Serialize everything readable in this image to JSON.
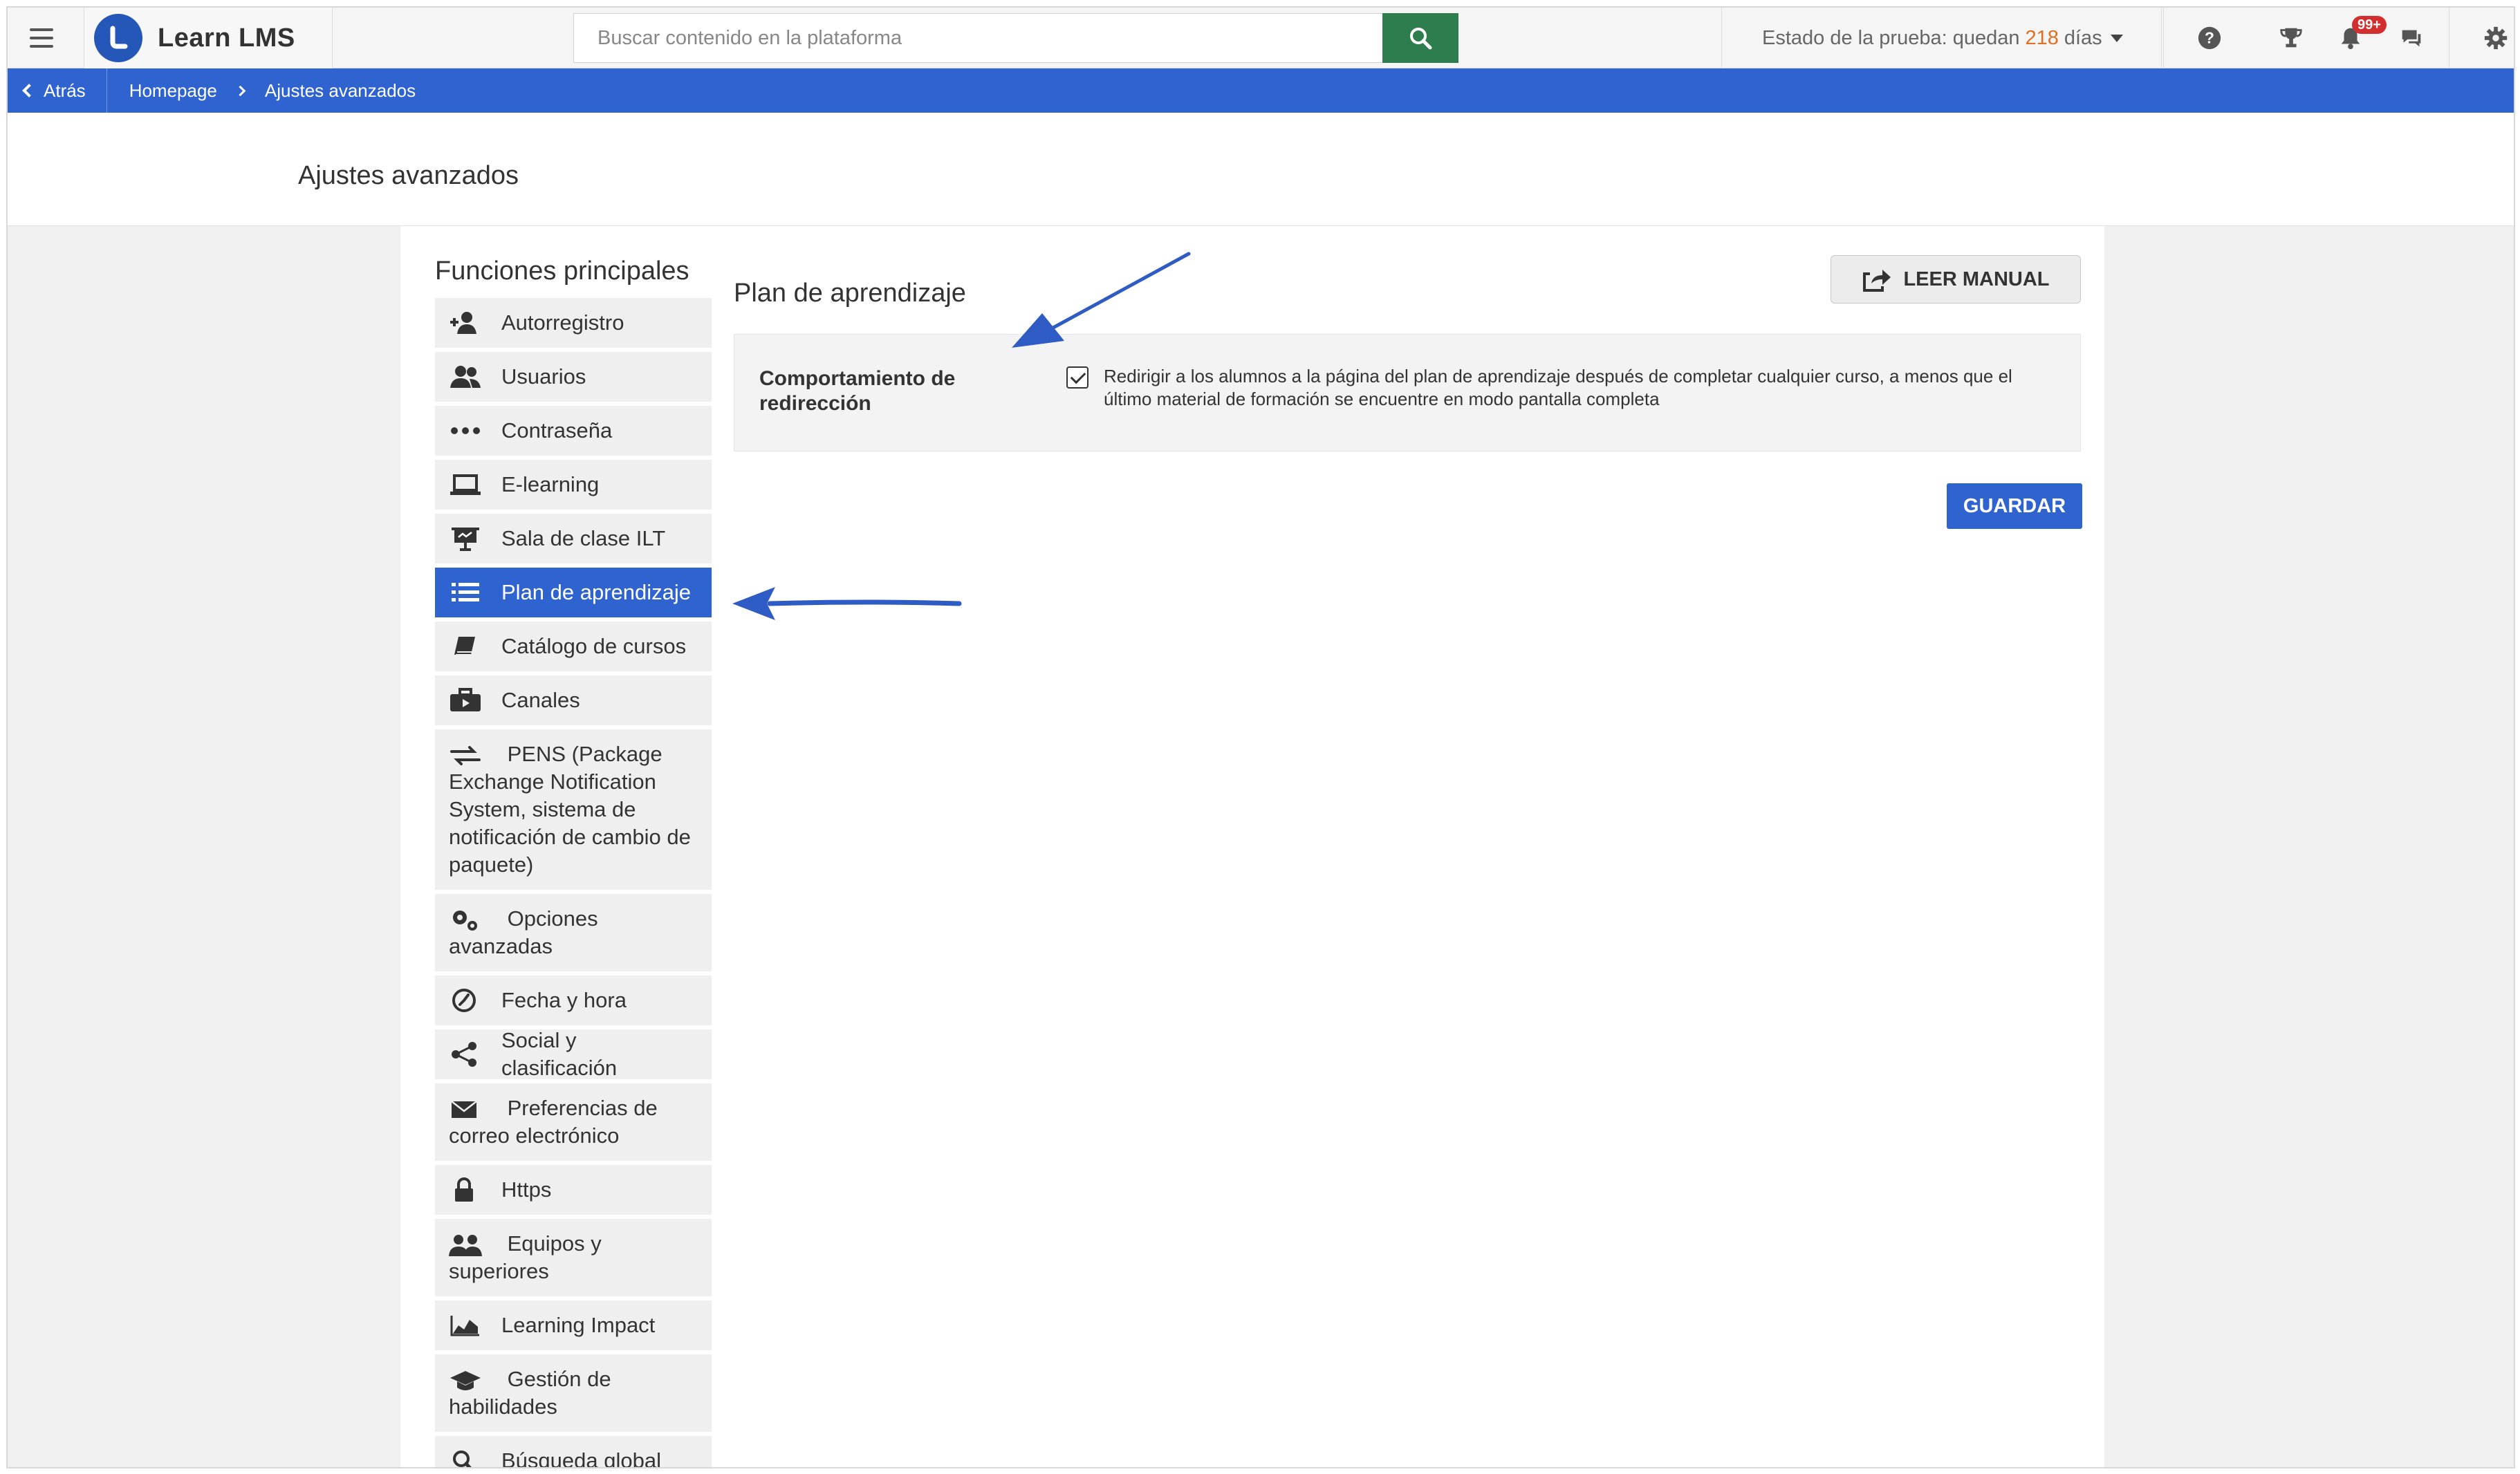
{
  "app": {
    "name": "Learn LMS"
  },
  "search": {
    "placeholder": "Buscar contenido en la plataforma"
  },
  "trial": {
    "prefix": "Estado de la prueba: quedan",
    "days": "218",
    "suffix": "días"
  },
  "notifications": {
    "badge": "99+"
  },
  "breadcrumb": {
    "back": "Atrás",
    "home": "Homepage",
    "current": "Ajustes avanzados"
  },
  "page": {
    "title": "Ajustes avanzados"
  },
  "sidebar": {
    "title": "Funciones principales",
    "items": [
      {
        "label": "Autorregistro",
        "icon": "user-add-icon"
      },
      {
        "label": "Usuarios",
        "icon": "users-icon"
      },
      {
        "label": "Contraseña",
        "icon": "password-dots-icon"
      },
      {
        "label": "E-learning",
        "icon": "laptop-icon"
      },
      {
        "label": "Sala de clase ILT",
        "icon": "presentation-icon"
      },
      {
        "label": "Plan de aprendizaje",
        "icon": "list-icon",
        "active": true
      },
      {
        "label": "Catálogo de cursos",
        "icon": "book-icon"
      },
      {
        "label": "Canales",
        "icon": "briefcase-icon"
      },
      {
        "label": "PENS (Package Exchange Notification System, sistema de notificación de cambio de paquete)",
        "icon": "exchange-icon"
      },
      {
        "label": "Opciones avanzadas",
        "icon": "gears-icon"
      },
      {
        "label": "Fecha y hora",
        "icon": "clock-icon"
      },
      {
        "label": "Social y clasificación",
        "icon": "share-icon"
      },
      {
        "label": "Preferencias de correo electrónico",
        "icon": "envelope-icon"
      },
      {
        "label": "Https",
        "icon": "lock-icon"
      },
      {
        "label": "Equipos y superiores",
        "icon": "team-icon"
      },
      {
        "label": "Learning Impact",
        "icon": "area-chart-icon"
      },
      {
        "label": "Gestión de habilidades",
        "icon": "graduation-cap-icon"
      },
      {
        "label": "Búsqueda global",
        "icon": "search-icon"
      }
    ]
  },
  "content": {
    "title": "Plan de aprendizaje",
    "manual_button": "LEER MANUAL",
    "setting_label": "Comportamiento de redirección",
    "setting_checked": true,
    "setting_description": "Redirigir a los alumnos a la página del plan de aprendizaje después de completar cualquier curso, a menos que el último material de formación se encuentre en modo pantalla completa",
    "save_button": "GUARDAR"
  },
  "colors": {
    "brand_blue": "#2e63d0",
    "search_green": "#2e7d4f",
    "trial_days": "#e07020",
    "badge_red": "#d32f2f",
    "annotation_arrow": "#2f5cc4"
  }
}
